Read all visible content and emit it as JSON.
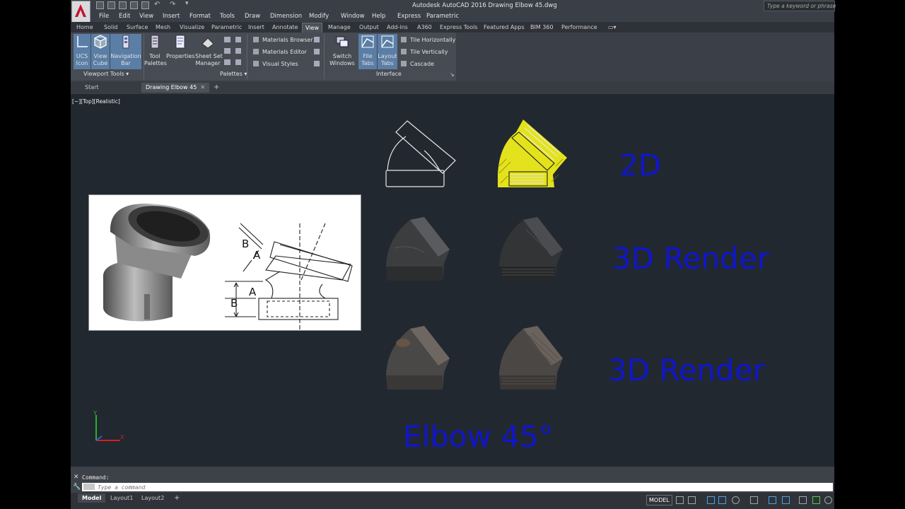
{
  "app": {
    "title": "Autodesk AutoCAD 2016    Drawing Elbow 45.dwg",
    "search_placeholder": "Type a keyword or phrase"
  },
  "menu": [
    "File",
    "Edit",
    "View",
    "Insert",
    "Format",
    "Tools",
    "Draw",
    "Dimension",
    "Modify",
    "Window",
    "Help",
    "Express",
    "Parametric"
  ],
  "ribbon_tabs": [
    "Home",
    "Solid",
    "Surface",
    "Mesh",
    "Visualize",
    "Parametric",
    "Insert",
    "Annotate",
    "View",
    "Manage",
    "Output",
    "Add-ins",
    "A360",
    "Express Tools",
    "Featured Apps",
    "BIM 360",
    "Performance"
  ],
  "ribbon_active_tab": "View",
  "viewport_tools": {
    "ucs_icon": "UCS\nIcon",
    "view_cube": "View\nCube",
    "navigation_bar": "Navigation\nBar",
    "title": "Viewport Tools"
  },
  "palettes": {
    "tool_palettes": "Tool\nPalettes",
    "properties": "Properties",
    "sheet_set_manager": "Sheet Set\nManager",
    "materials_browser": "Materials Browser",
    "materials_editor": "Materials Editor",
    "visual_styles": "Visual Styles",
    "title": "Palettes"
  },
  "interface": {
    "switch_windows": "Switch\nWindows",
    "file_tabs": "File\nTabs",
    "layout_tabs": "Layout\nTabs",
    "tile_horizontally": "Tile Horizontally",
    "tile_vertically": "Tile Vertically",
    "cascade": "Cascade",
    "title": "Interface"
  },
  "doc_tabs": [
    "Start",
    "Drawing Elbow 45"
  ],
  "viewport_label": "[−][Top][Realistic]",
  "canvas_labels": {
    "label_2d": "2D",
    "label_3d_1": "3D Render",
    "label_3d_2": "3D Render",
    "label_elbow": "Elbow 45°"
  },
  "reference_dims": [
    "B",
    "A",
    "A",
    "B"
  ],
  "command": {
    "history": "Command:",
    "placeholder": "Type a command"
  },
  "layout_tabs": [
    "Model",
    "Layout1",
    "Layout2"
  ],
  "status": {
    "model": "MODEL"
  },
  "colors": {
    "canvas_bg": "#212830",
    "label_blue": "#1116c8",
    "hatch_yellow": "#e4e21c"
  }
}
